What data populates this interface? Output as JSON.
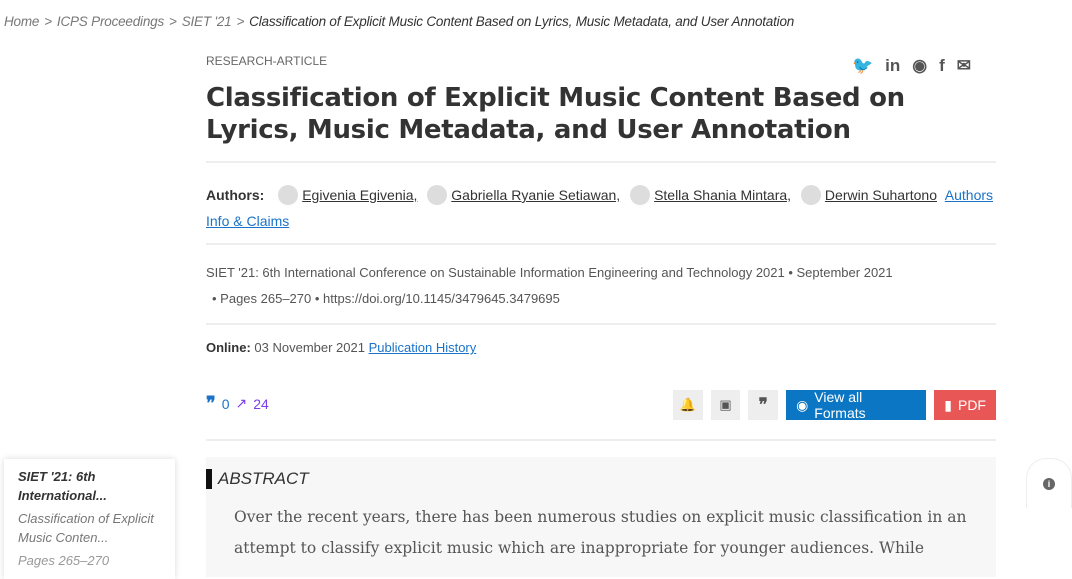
{
  "breadcrumb": [
    "Home",
    "ICPS Proceedings",
    "SIET '21",
    "Classification of Explicit Music Content Based on Lyrics, Music Metadata, and User Annotation"
  ],
  "article_type": "RESEARCH-ARTICLE",
  "title": "Classification of Explicit Music Content Based on Lyrics, Music Metadata, and User Annotation",
  "authors_label": "Authors:",
  "authors": [
    "Egivenia Egivenia,",
    "Gabriella Ryanie Setiawan,",
    "Stella Shania Mintara,",
    "Derwin Suhartono"
  ],
  "authors_info": "Authors Info & Claims",
  "conference": "SIET '21: 6th International Conference on Sustainable Information Engineering and Technology 2021 • September 2021",
  "pages_doi": "• Pages 265–270 • https://doi.org/10.1145/3479645.3479695",
  "online_label": "Online:",
  "online_date": "03 November 2021",
  "publication_history": "Publication History",
  "citations": "0",
  "downloads": "24",
  "view_formats": "View all Formats",
  "pdf": "PDF",
  "abstract_heading": "ABSTRACT",
  "abstract_text": "Over the recent years, there has been numerous studies on explicit music classification in an attempt to classify explicit music which are inappropriate for younger audiences. While",
  "sidebar": {
    "conf": "SIET '21: 6th International...",
    "title": "Classification of Explicit Music Conten...",
    "pages": "Pages 265–270"
  }
}
